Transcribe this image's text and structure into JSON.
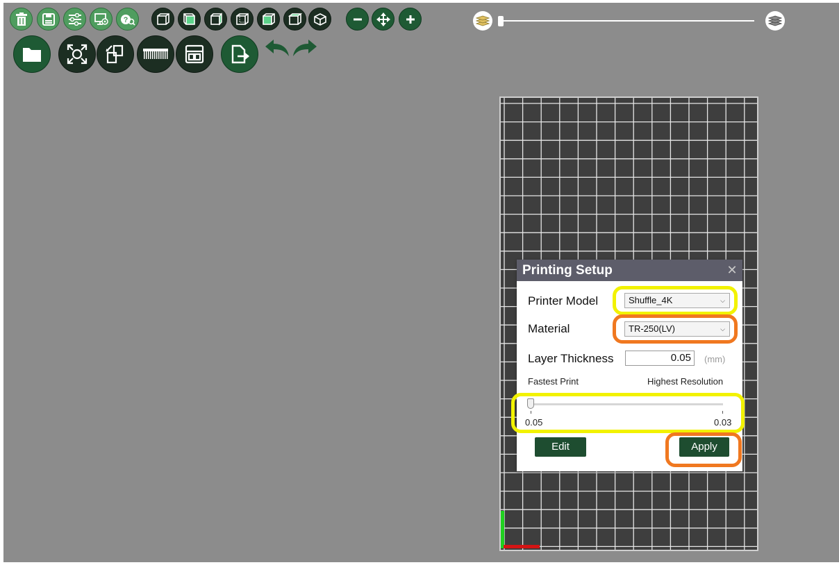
{
  "toolbar": {
    "top_row": [
      {
        "icon": "trash-icon",
        "tooltip": ""
      },
      {
        "icon": "save-icon",
        "tooltip": ""
      },
      {
        "icon": "settings-sliders-icon",
        "tooltip": ""
      },
      {
        "icon": "monitor-settings-icon",
        "tooltip": ""
      },
      {
        "icon": "help-search-icon",
        "tooltip": ""
      },
      {
        "icon": "view-cube-front-icon",
        "tooltip": ""
      },
      {
        "icon": "view-cube-left-icon",
        "tooltip": ""
      },
      {
        "icon": "view-cube-right-icon",
        "tooltip": ""
      },
      {
        "icon": "view-cube-back-icon",
        "tooltip": ""
      },
      {
        "icon": "view-cube-top-icon",
        "tooltip": ""
      },
      {
        "icon": "view-cube-bottom-icon",
        "tooltip": ""
      },
      {
        "icon": "view-cube-iso-icon",
        "tooltip": ""
      },
      {
        "icon": "zoom-out-icon",
        "tooltip": ""
      },
      {
        "icon": "pan-move-icon",
        "tooltip": ""
      },
      {
        "icon": "zoom-in-icon",
        "tooltip": ""
      }
    ],
    "bottom_row": [
      {
        "icon": "open-folder-icon"
      },
      {
        "icon": "fit-view-icon"
      },
      {
        "icon": "edit-copy-icon"
      },
      {
        "icon": "support-comb-icon"
      },
      {
        "icon": "layout-icon"
      },
      {
        "icon": "export-icon"
      },
      {
        "icon": "undo-icon"
      },
      {
        "icon": "redo-icon"
      }
    ]
  },
  "layer_slider": {
    "left_icon": "layers-bottom-icon",
    "right_icon": "layers-top-icon",
    "position": 0
  },
  "dialog": {
    "title": "Printing Setup",
    "close_icon": "close-x-icon",
    "printer_model": {
      "label": "Printer Model",
      "value": "Shuffle_4K"
    },
    "material": {
      "label": "Material",
      "value": "TR-250(LV)"
    },
    "layer_thickness": {
      "label": "Layer Thickness",
      "value": "0.05",
      "unit": "(mm)"
    },
    "resolution": {
      "left_label": "Fastest Print",
      "right_label": "Highest Resolution",
      "min_label": "0.05",
      "max_label": "0.03",
      "value": 0.05
    },
    "edit_label": "Edit",
    "apply_label": "Apply"
  },
  "colors": {
    "viewport_bg": "#8c8c8c",
    "dialog_title_bg": "#5d5d6a",
    "button_green": "#1e4d30",
    "highlight_yellow": "#f2f200",
    "highlight_orange": "#f07820"
  }
}
